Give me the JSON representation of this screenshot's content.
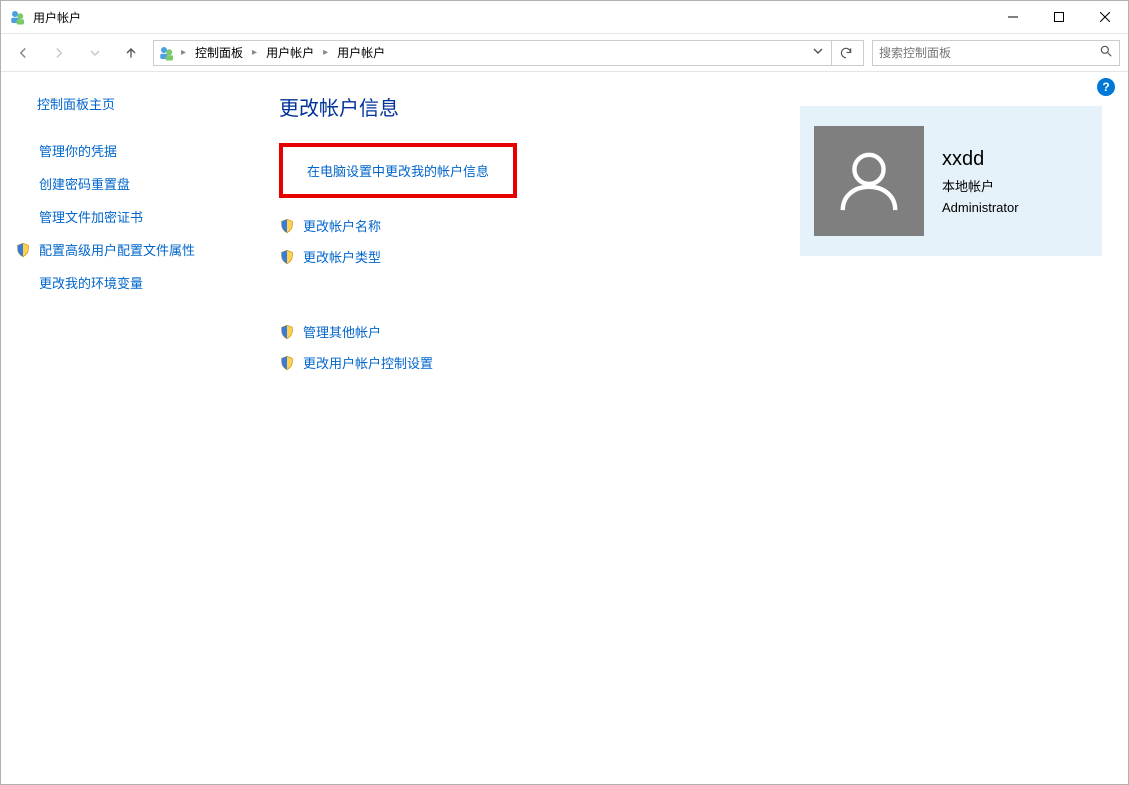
{
  "titlebar": {
    "title": "用户帐户"
  },
  "breadcrumb": {
    "items": [
      "控制面板",
      "用户帐户",
      "用户帐户"
    ]
  },
  "search": {
    "placeholder": "搜索控制面板"
  },
  "sidebar": {
    "home": "控制面板主页",
    "links": {
      "manage_credentials": "管理你的凭据",
      "create_reset_disk": "创建密码重置盘",
      "manage_encrypt_certs": "管理文件加密证书",
      "configure_profile": "配置高级用户配置文件属性",
      "change_env_vars": "更改我的环境变量"
    }
  },
  "main": {
    "heading": "更改帐户信息",
    "highlight_link": "在电脑设置中更改我的帐户信息",
    "actions": {
      "change_name": "更改帐户名称",
      "change_type": "更改帐户类型",
      "manage_others": "管理其他帐户",
      "change_uac": "更改用户帐户控制设置"
    }
  },
  "user_card": {
    "username": "xxdd",
    "account_type": "本地帐户",
    "privilege": "Administrator"
  },
  "help_badge": "?"
}
